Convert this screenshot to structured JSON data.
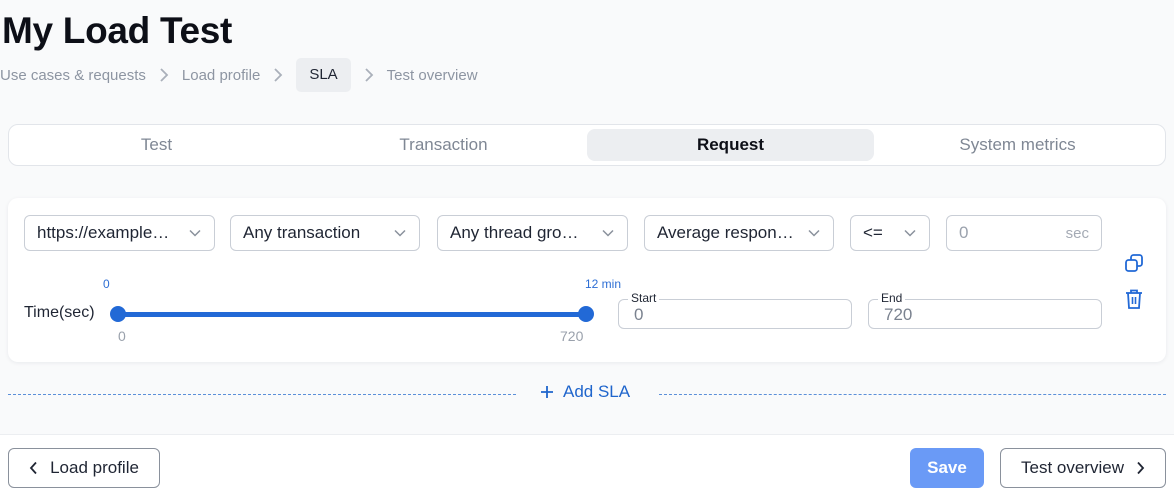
{
  "page_title": "My Load Test",
  "breadcrumb": [
    "Use cases & requests",
    "Load profile",
    "SLA",
    "Test overview"
  ],
  "tabs": [
    "Test",
    "Transaction",
    "Request",
    "System metrics"
  ],
  "active_tab": "Request",
  "sla_row": {
    "url_select": "https://example…",
    "transaction_select": "Any transaction",
    "thread_group_select": "Any thread gro…",
    "metric_select": "Average respon…",
    "operator_select": "<=",
    "threshold_value": "0",
    "threshold_unit": "sec"
  },
  "time_range": {
    "label": "Time(sec)",
    "top_left": "0",
    "top_right": "12 min",
    "bottom_left": "0",
    "bottom_right": "720",
    "start_label": "Start",
    "start_value": "0",
    "end_label": "End",
    "end_value": "720"
  },
  "add_sla_label": "Add SLA",
  "footer": {
    "back_label": "Load profile",
    "save_label": "Save",
    "next_label": "Test overview"
  },
  "colors": {
    "accent": "#2269d6",
    "primary_button": "#6a9af6",
    "tab_active_bg": "#eceef1"
  },
  "icons": [
    "chevron-right-icon",
    "chevron-down-icon",
    "copy-icon",
    "trash-icon",
    "plus-icon",
    "chevron-left-icon"
  ]
}
